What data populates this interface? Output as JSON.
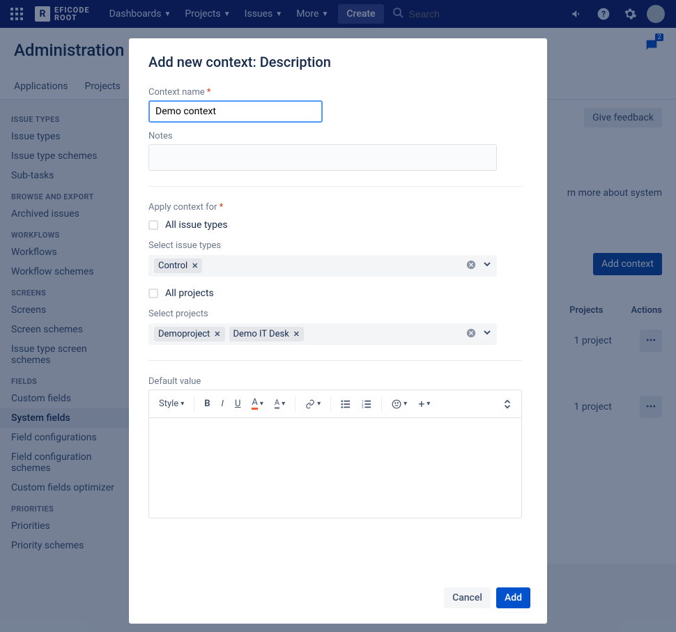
{
  "nav": {
    "brand_top": "EFICODE",
    "brand_bottom": "ROOT",
    "items": [
      "Dashboards",
      "Projects",
      "Issues",
      "More"
    ],
    "create": "Create",
    "search_placeholder": "Search"
  },
  "page": {
    "title": "Administration",
    "tabs": [
      "Applications",
      "Projects"
    ],
    "feedback": "Give feedback",
    "info_fragment": "rn more about system",
    "add_context": "Add context",
    "col_projects": "Projects",
    "col_actions": "Actions",
    "row_projects_1": "1 project",
    "row_projects_2": "1 project",
    "notif_badge": "2"
  },
  "sidebar": {
    "groups": [
      {
        "label": "ISSUE TYPES",
        "items": [
          "Issue types",
          "Issue type schemes",
          "Sub-tasks"
        ]
      },
      {
        "label": "BROWSE AND EXPORT",
        "items": [
          "Archived issues"
        ]
      },
      {
        "label": "WORKFLOWS",
        "items": [
          "Workflows",
          "Workflow schemes"
        ]
      },
      {
        "label": "SCREENS",
        "items": [
          "Screens",
          "Screen schemes",
          "Issue type screen schemes"
        ]
      },
      {
        "label": "FIELDS",
        "items": [
          "Custom fields",
          "System fields",
          "Field configurations",
          "Field configuration schemes",
          "Custom fields optimizer"
        ]
      },
      {
        "label": "PRIORITIES",
        "items": [
          "Priorities",
          "Priority schemes"
        ]
      }
    ],
    "active": "System fields"
  },
  "modal": {
    "title": "Add new context: Description",
    "context_name_label": "Context name",
    "context_name_value": "Demo context",
    "notes_label": "Notes",
    "apply_label": "Apply context for",
    "all_issue_types": "All issue types",
    "select_issue_types": "Select issue types",
    "issue_type_tags": [
      "Control"
    ],
    "all_projects": "All projects",
    "select_projects": "Select projects",
    "project_tags": [
      "Demoproject",
      "Demo IT Desk"
    ],
    "default_value": "Default value",
    "style_btn": "Style",
    "cancel": "Cancel",
    "add": "Add"
  }
}
